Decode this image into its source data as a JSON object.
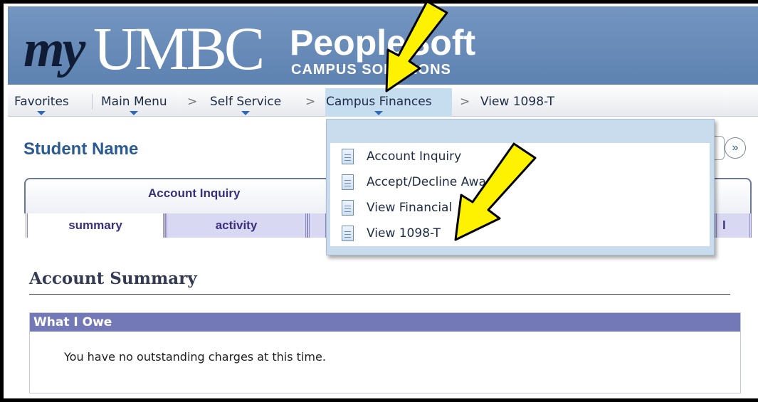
{
  "header": {
    "logo_my": "my",
    "logo_umbc": "UMBC",
    "logo_peoplesoft": "PeopleSoft",
    "logo_sub": "CAMPUS SOLUTIONS"
  },
  "nav": {
    "items": [
      {
        "label": "Favorites"
      },
      {
        "label": "Main Menu"
      },
      {
        "label": "Self Service"
      },
      {
        "label": "Campus Finances"
      },
      {
        "label": "View 1098-T"
      }
    ],
    "separator": ">"
  },
  "page": {
    "student_name": "Student Name",
    "next_icon": "double-chevron-right-icon",
    "tab_title": "Account Inquiry",
    "subtabs": [
      {
        "label": "summary",
        "selected": true
      },
      {
        "label": "activity",
        "selected": false
      },
      {
        "label": "l",
        "selected": false
      }
    ],
    "section_title": "Account Summary",
    "owe_header": "What I Owe",
    "owe_message": "You have no outstanding charges at this time."
  },
  "dropdown": {
    "items": [
      {
        "label": "Account Inquiry",
        "icon": "page-icon"
      },
      {
        "label": "Accept/Decline Awards",
        "icon": "page-icon"
      },
      {
        "label": "View Financial",
        "icon": "page-icon"
      },
      {
        "label": "View 1098-T",
        "icon": "page-icon"
      }
    ]
  },
  "annotations": {
    "arrow_color": "#fff200"
  }
}
